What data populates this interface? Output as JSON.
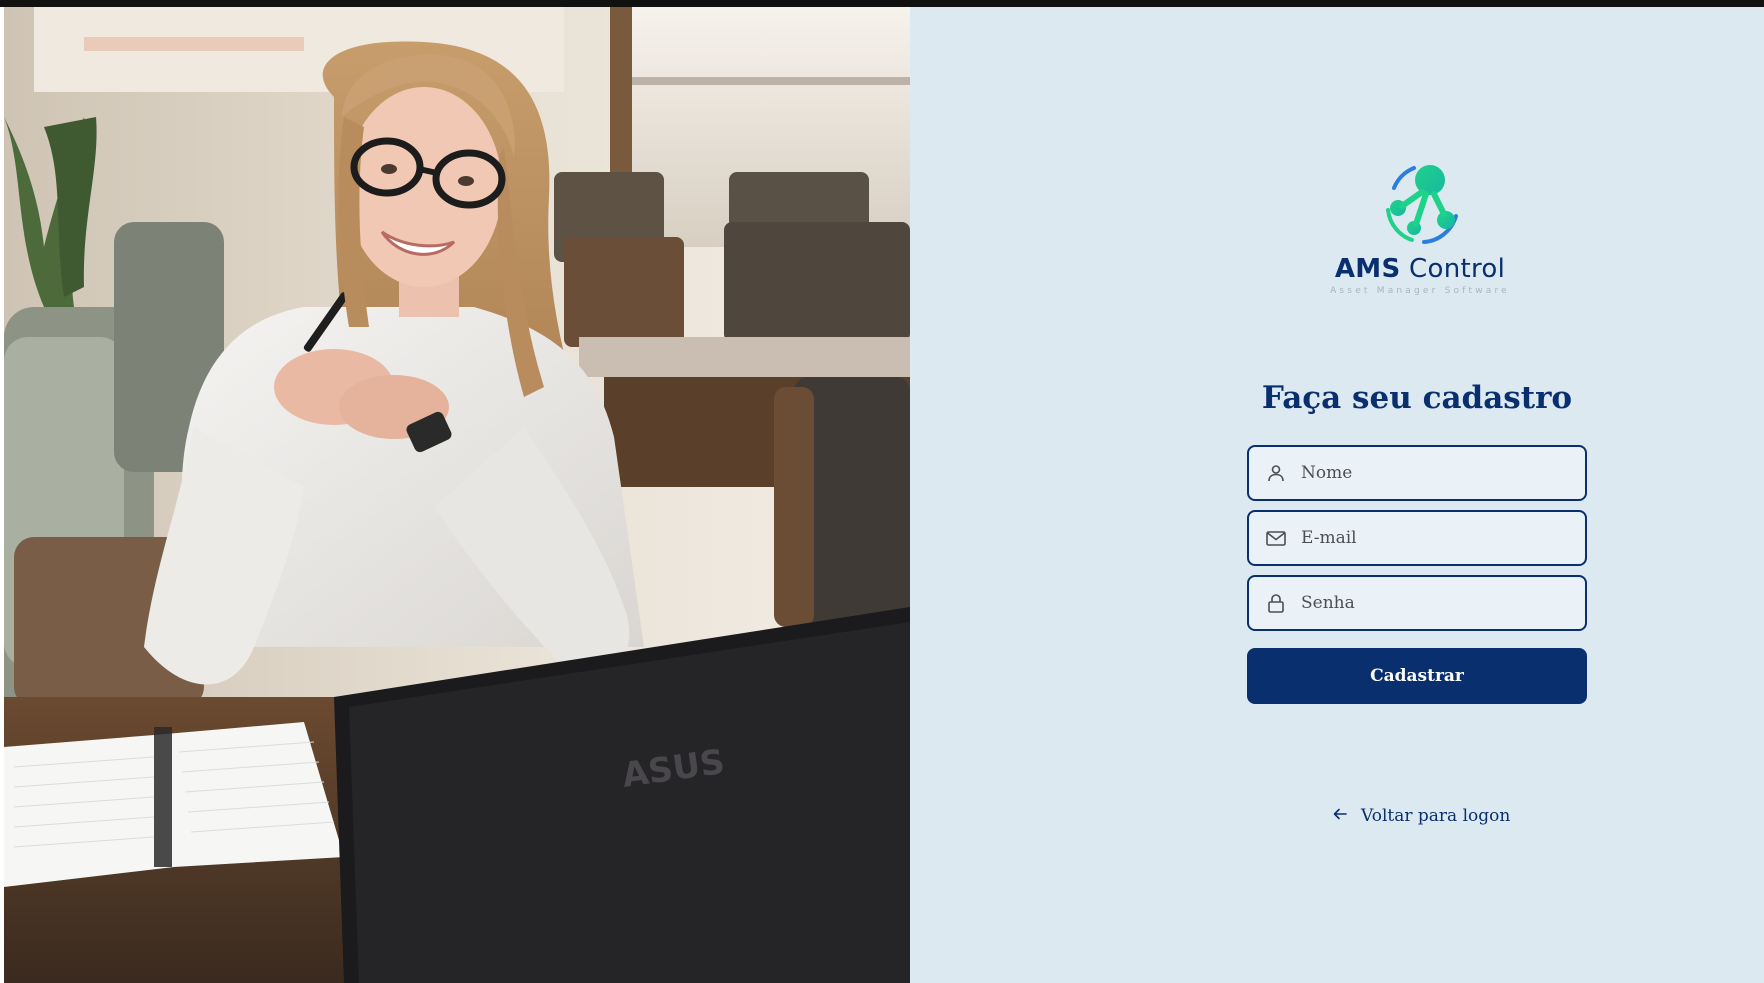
{
  "hero_image": {
    "description_icon": "photo-woman-at-laptop",
    "laptop_brand": "ASUS"
  },
  "brand": {
    "name_bold": "AMS",
    "name_light": "Control",
    "tagline": "Asset Manager Software",
    "logo_icon": "molecule-logo-icon"
  },
  "form": {
    "title": "Faça seu cadastro",
    "name_placeholder": "Nome",
    "email_placeholder": "E-mail",
    "password_placeholder": "Senha",
    "submit_label": "Cadastrar"
  },
  "back_link": {
    "label": "Voltar para logon",
    "icon": "arrow-left-icon"
  },
  "colors": {
    "primary": "#0a2f6e",
    "panel_bg": "#dde9f1",
    "logo_green": "#1fd28a",
    "logo_blue": "#2a7de1"
  }
}
